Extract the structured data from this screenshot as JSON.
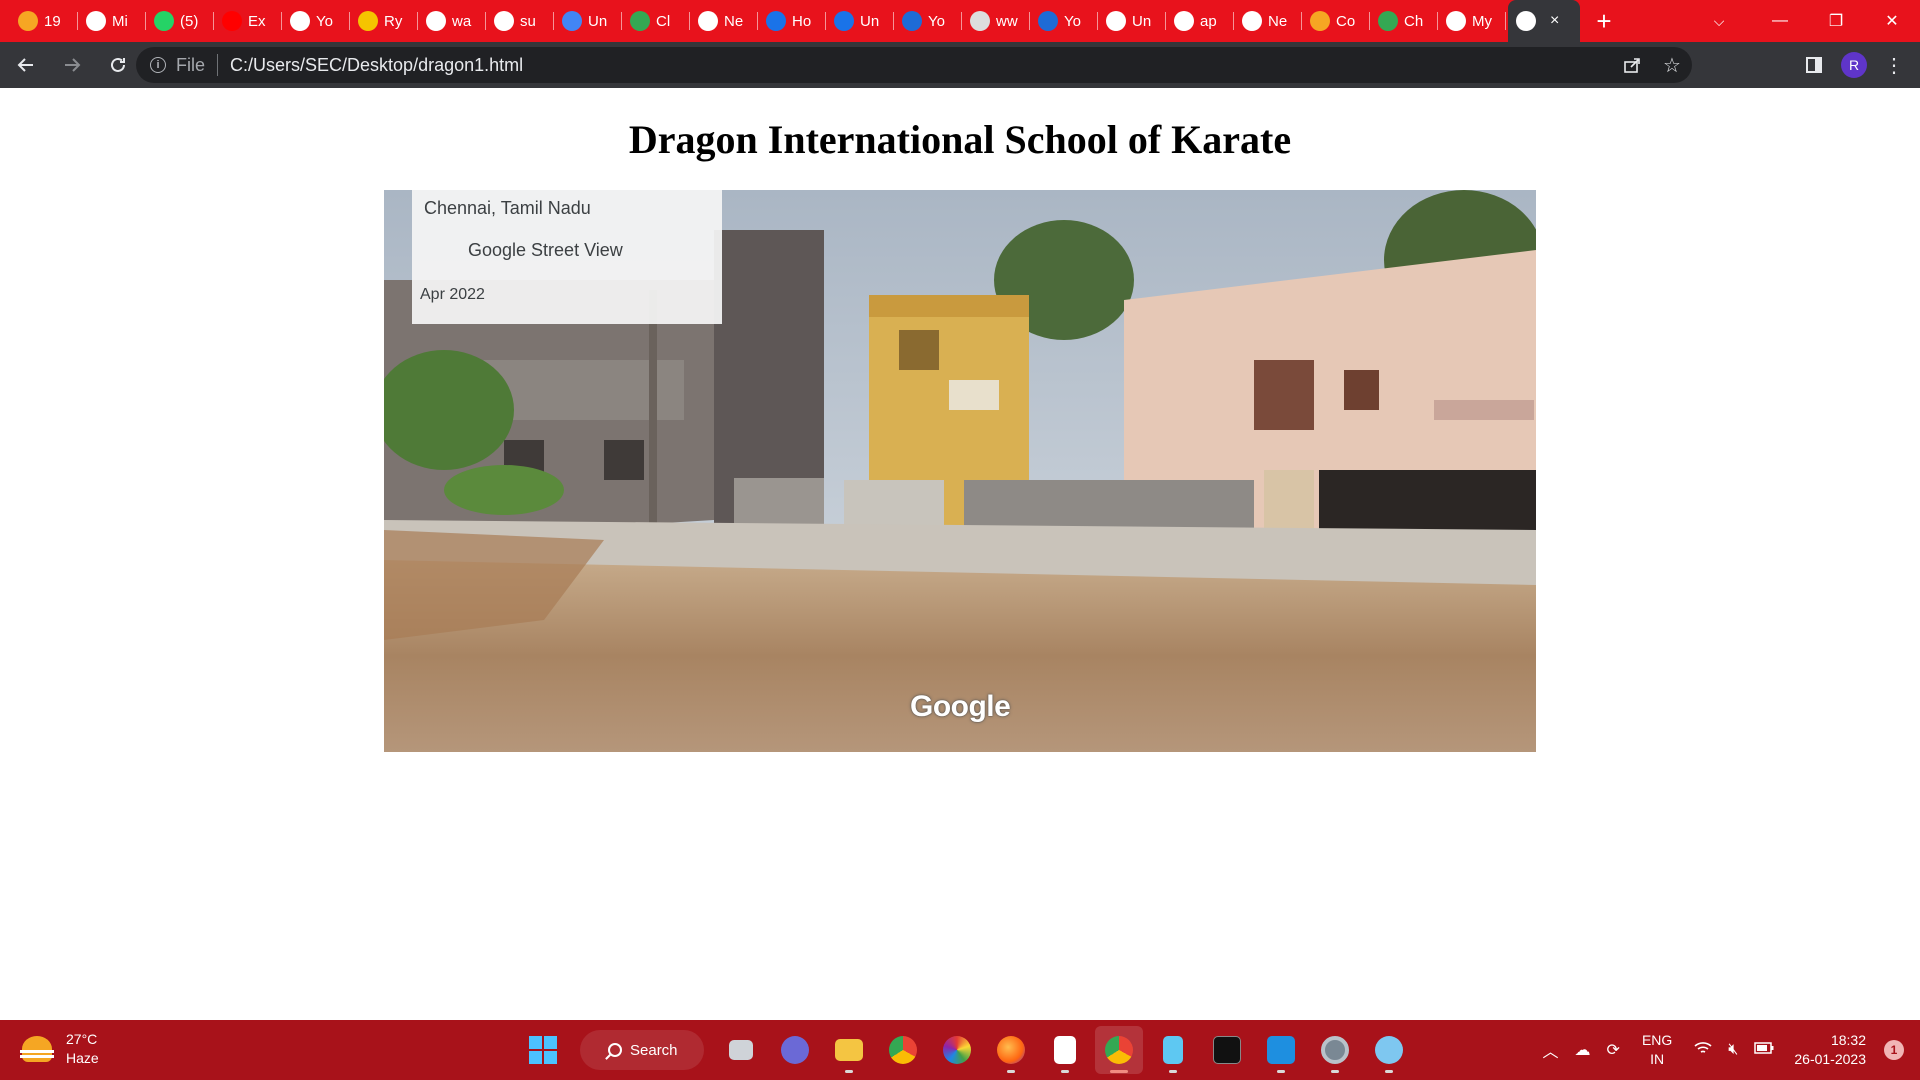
{
  "browser": {
    "tabs": [
      {
        "label": "19",
        "icon": "tab-icon",
        "color": "#f6a623"
      },
      {
        "label": "Mi",
        "icon": "github-icon",
        "color": "#ffffff"
      },
      {
        "label": "(5)",
        "icon": "whatsapp-icon",
        "color": "#25d366"
      },
      {
        "label": "Ex",
        "icon": "youtube-icon",
        "color": "#ff0000"
      },
      {
        "label": "Yo",
        "icon": "github-icon",
        "color": "#ffffff"
      },
      {
        "label": "Ry",
        "icon": "tab-icon",
        "color": "#f5c400"
      },
      {
        "label": "wa",
        "icon": "google-icon",
        "color": "#ffffff"
      },
      {
        "label": "su",
        "icon": "google-icon",
        "color": "#ffffff"
      },
      {
        "label": "Un",
        "icon": "docs-icon",
        "color": "#4285f4"
      },
      {
        "label": "Cl",
        "icon": "drive-icon",
        "color": "#34a853"
      },
      {
        "label": "Ne",
        "icon": "chrome-icon",
        "color": "#ffffff"
      },
      {
        "label": "Ho",
        "icon": "c-icon",
        "color": "#1a73e8"
      },
      {
        "label": "Un",
        "icon": "c-icon",
        "color": "#1a73e8"
      },
      {
        "label": "Yo",
        "icon": "s-icon",
        "color": "#1e6bd6"
      },
      {
        "label": "ww",
        "icon": "globe-icon",
        "color": "#dddddd"
      },
      {
        "label": "Yo",
        "icon": "s-icon",
        "color": "#1e6bd6"
      },
      {
        "label": "Un",
        "icon": "globe-icon",
        "color": "#ffffff"
      },
      {
        "label": "ap",
        "icon": "google-icon",
        "color": "#ffffff"
      },
      {
        "label": "Ne",
        "icon": "chrome-icon",
        "color": "#ffffff"
      },
      {
        "label": "Co",
        "icon": "tab-icon",
        "color": "#f6a623"
      },
      {
        "label": "Ch",
        "icon": "maps-icon",
        "color": "#34a853"
      },
      {
        "label": "My",
        "icon": "globe-icon",
        "color": "#ffffff"
      }
    ],
    "active_tab": {
      "icon": "globe-icon",
      "close": "×"
    },
    "new_tab": "+",
    "window_controls": {
      "down": "⌵",
      "minimize": "—",
      "restore": "❐",
      "close": "✕"
    },
    "address": {
      "scheme": "File",
      "url": "C:/Users/SEC/Desktop/dragon1.html"
    },
    "profile_initial": "R"
  },
  "page": {
    "title": "Dragon International School of Karate",
    "street_view": {
      "location": "Chennai, Tamil Nadu",
      "link": "Google Street View",
      "date": "Apr 2022",
      "logo": "Google"
    }
  },
  "taskbar": {
    "weather": {
      "temp": "27°C",
      "condition": "Haze"
    },
    "search_label": "Search",
    "language": {
      "line1": "ENG",
      "line2": "IN"
    },
    "clock": {
      "time": "18:32",
      "date": "26-01-2023"
    },
    "notification_count": "1",
    "colors": {
      "taskbar": "#a8121a",
      "tabstrip": "#e8121c",
      "toolbar": "#35363a"
    }
  }
}
